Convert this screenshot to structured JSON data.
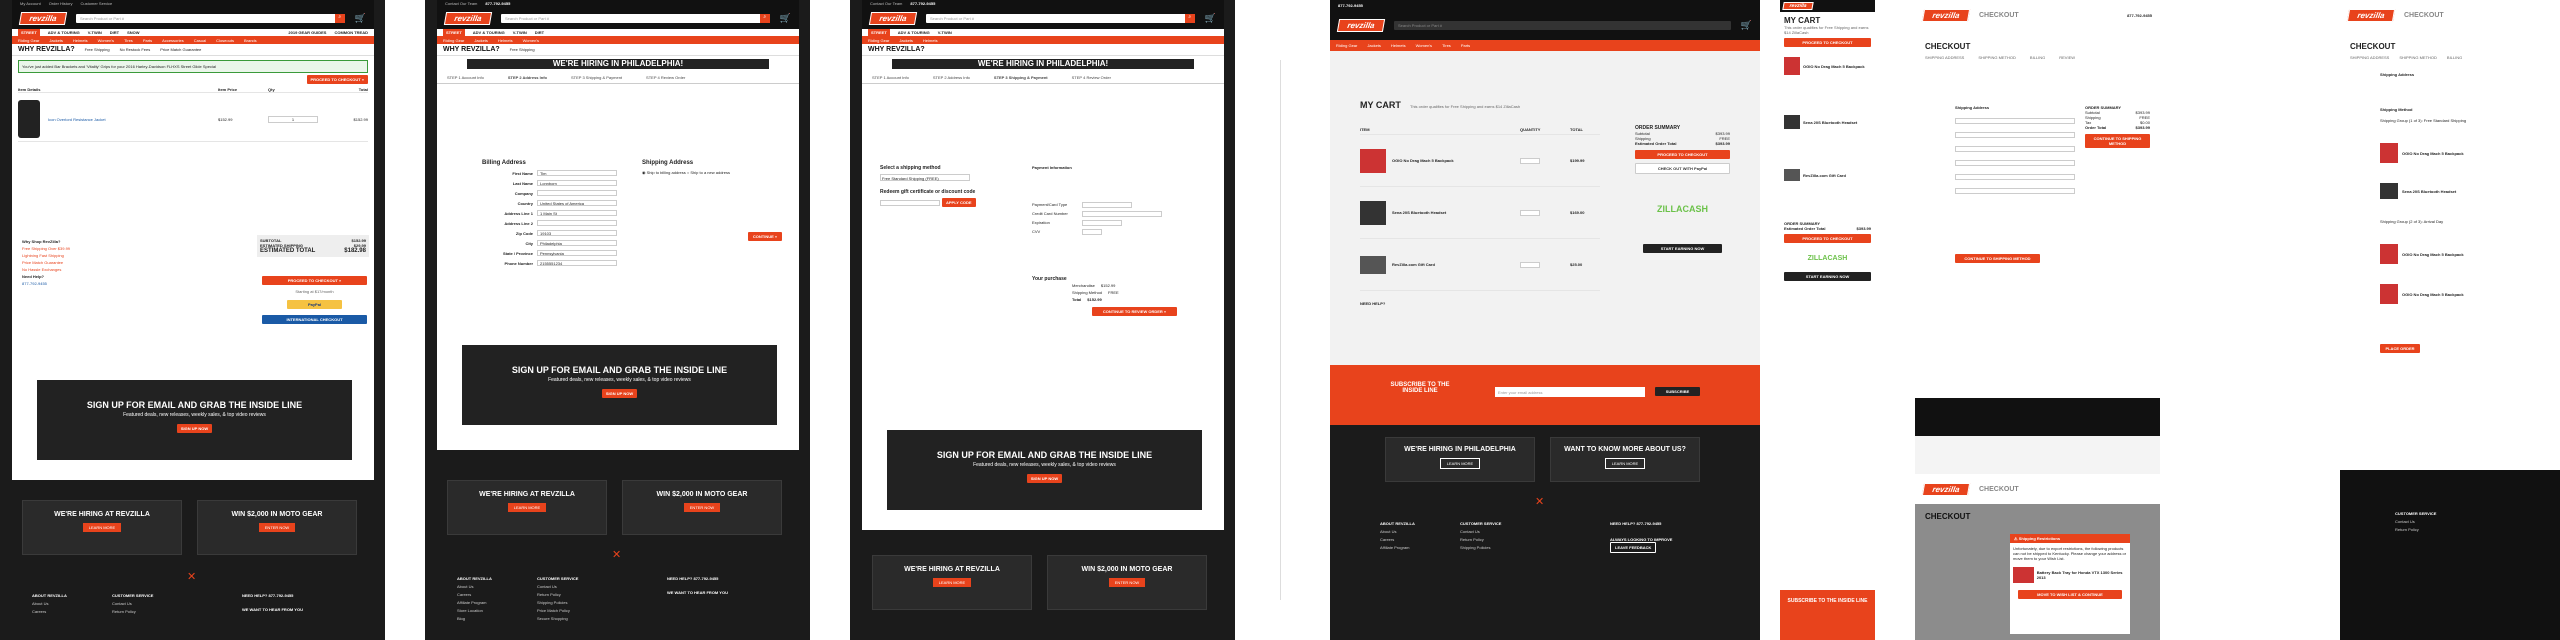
{
  "topbar": {
    "links": [
      "Contact Our Team",
      "877-792-9455",
      "My Account",
      "Order History",
      "Customer Service"
    ]
  },
  "search": {
    "placeholder": "Search Product or Part #"
  },
  "nav1": [
    "STREET",
    "ADV & TOURING",
    "V-TWIN",
    "DIRT",
    "SNOW",
    "2019 GEAR GUIDES",
    "COMMON TREAD"
  ],
  "nav2": [
    "Riding Gear",
    "Jackets",
    "Helmets",
    "Women's",
    "Tires",
    "Parts",
    "Accessories",
    "Casual",
    "Closeouts",
    "Brands"
  ],
  "why": {
    "title": "WHY REVZILLA?",
    "items": [
      "Free Shipping",
      "No Restock Fees",
      "Price Match Guarantee"
    ]
  },
  "promo": "You've just added Bar Brackets and 'Vitality' Grips for your 2016 Harley-Davidson FLHXS Street Glide Special",
  "hiring": "WE'RE HIRING IN PHILADELPHIA!",
  "cart": {
    "headers": [
      "Item Details",
      "Item Price",
      "Qty",
      "Total"
    ],
    "item": {
      "name": "Icon Overlord Resistance Jacket",
      "price": "$152.99",
      "qty": "1",
      "total": "$152.99",
      "remove": "REMOVE"
    },
    "subtotal_label": "SUBTOTAL",
    "subtotal": "$152.99",
    "shipping_label": "ESTIMATED SHIPPING",
    "shipping": "$29.99",
    "total_label": "ESTIMATED TOTAL",
    "total": "$182.98",
    "checkout": "PROCEED TO CHECKOUT »",
    "affirm": "Starting at $17/month",
    "paypal": "PayPal",
    "intl": "INTERNATIONAL CHECKOUT",
    "why_title": "Why Shop RevZilla?",
    "why_list": [
      "Free Shipping Over $39.99",
      "Lightning Fast Shipping",
      "Price Match Guarantee",
      "No Hassle Exchanges"
    ],
    "help": "Need Help?",
    "phone": "877-792-9455"
  },
  "signup": {
    "title": "SIGN UP FOR EMAIL AND GRAB THE INSIDE LINE",
    "sub": "Featured deals, new releases, weekly sales, & top video reviews",
    "btn": "SIGN UP NOW"
  },
  "tiles": [
    {
      "title": "WE'RE HIRING AT REVZILLA",
      "btn": "LEARN MORE"
    },
    {
      "title": "WIN $2,000 IN MOTO GEAR",
      "btn": "ENTER NOW"
    }
  ],
  "footer": {
    "about": {
      "title": "ABOUT REVZILLA",
      "links": [
        "About Us",
        "Careers",
        "Affiliate Program",
        "Store Location",
        "Blog"
      ]
    },
    "cs": {
      "title": "CUSTOMER SERVICE",
      "links": [
        "Contact Us",
        "Return Policy",
        "Shipping Policies",
        "Price Match Policy",
        "Secure Shopping"
      ]
    },
    "help": "NEED HELP?",
    "phone": "877-792-9455",
    "hear": "WE WANT TO HEAR FROM YOU"
  },
  "checkout": {
    "steps": [
      "STEP 1 Account Info",
      "STEP 2 Address Info",
      "STEP 3 Shipping & Payment",
      "STEP 4 Review Order"
    ],
    "billing_title": "Billing Address",
    "shipping_title": "Shipping Address",
    "fields": [
      "First Name",
      "Last Name",
      "Company",
      "Country",
      "Address Line 1",
      "Address Line 2",
      "Zip Code",
      "City",
      "State / Province",
      "Phone Number"
    ],
    "values": [
      "Tim",
      "Lonnborn",
      "",
      "United States of America",
      "1 Main St",
      "",
      "19103",
      "Philadelphia",
      "Pennsylvania",
      "2155551234"
    ],
    "ship_same": "Ship to billing address",
    "ship_diff": "Ship to a new address",
    "continue": "CONTINUE »",
    "ship_method": "Select a shipping method",
    "ship_option": "Free Standard Shipping (FREE)",
    "redeem": "Redeem gift certificate or discount code",
    "apply": "APPLY CODE",
    "payment": "Payment Information",
    "pay_fields": [
      "Payment/Card Type",
      "Credit Card Number",
      "Expiration",
      "CVV"
    ],
    "purchase_title": "Your purchase",
    "purchase": [
      [
        "Merchandise",
        "$152.99"
      ],
      [
        "Shipping Method",
        "FREE"
      ],
      [
        "Total",
        "$152.99"
      ]
    ],
    "place": "CONTINUE TO REVIEW ORDER »"
  },
  "mycart": {
    "title": "MY CART",
    "note": "This order qualifies for Free Shipping and earns $14 ZillaCash",
    "headers": [
      "ITEM",
      "QUANTITY",
      "TOTAL"
    ],
    "items": [
      {
        "name": "OGIO No Drag Mach 5 Backpack",
        "price": "$199.99"
      },
      {
        "name": "Sena 20S Bluetooth Headset",
        "price": "$169.00"
      },
      {
        "name": "RevZilla.com Gift Card",
        "price": "$25.00"
      }
    ],
    "summary_title": "ORDER SUMMARY",
    "summary": [
      [
        "Subtotal",
        "$393.99"
      ],
      [
        "Shipping",
        "FREE"
      ],
      [
        "Estimated Order Total",
        "$393.99"
      ]
    ],
    "checkout": "PROCEED TO CHECKOUT",
    "paypal": "CHECK OUT WITH PayPal",
    "zillacash": "ZILLACASH",
    "start_earning": "START EARNING NOW",
    "need_help": "NEED HELP?",
    "subscribe": "SUBSCRIBE TO THE INSIDE LINE",
    "subscribe_btn": "SUBSCRIBE",
    "subscribe_ph": "Enter your email address",
    "tile1": "WE'RE HIRING IN PHILADELPHIA",
    "tile2": "WANT TO KNOW MORE ABOUT US?",
    "always": "ALWAYS LOOKING TO IMPROVE",
    "feedback": "LEAVE FEEDBACK"
  },
  "ckout": {
    "title": "CHECKOUT",
    "steps": [
      "SHIPPING ADDRESS",
      "SHIPPING METHOD",
      "BILLING",
      "REVIEW"
    ],
    "ship_addr": "Shipping Address",
    "summary": "ORDER SUMMARY",
    "sum_rows": [
      [
        "Subtotal",
        "$393.99"
      ],
      [
        "Shipping",
        "FREE"
      ],
      [
        "Tax",
        "$0.00"
      ],
      [
        "Order Total",
        "$393.99"
      ]
    ],
    "btn": "CONTINUE TO SHIPPING METHOD",
    "ship_method": "Shipping Method",
    "group1": "Shipping Group (1 of 3): Free Standard Shipping",
    "group2": "Shipping Group (2 of 3): Arrival Day",
    "place": "PLACE ORDER",
    "modal_title": "Shipping Restrictions",
    "modal_text": "Unfortunately, due to export restrictions, the following products can not be shipped to Kentucky. Please change your address or move them to your Wish List.",
    "modal_item": "Battery Back Tray for Honda VTX 1300 Series 2013",
    "modal_btn": "MOVE TO WISH LIST & CONTINUE"
  },
  "colors": {
    "brand": "#e8431c",
    "dark": "#1b1b1b",
    "blue": "#1a5aa6"
  }
}
